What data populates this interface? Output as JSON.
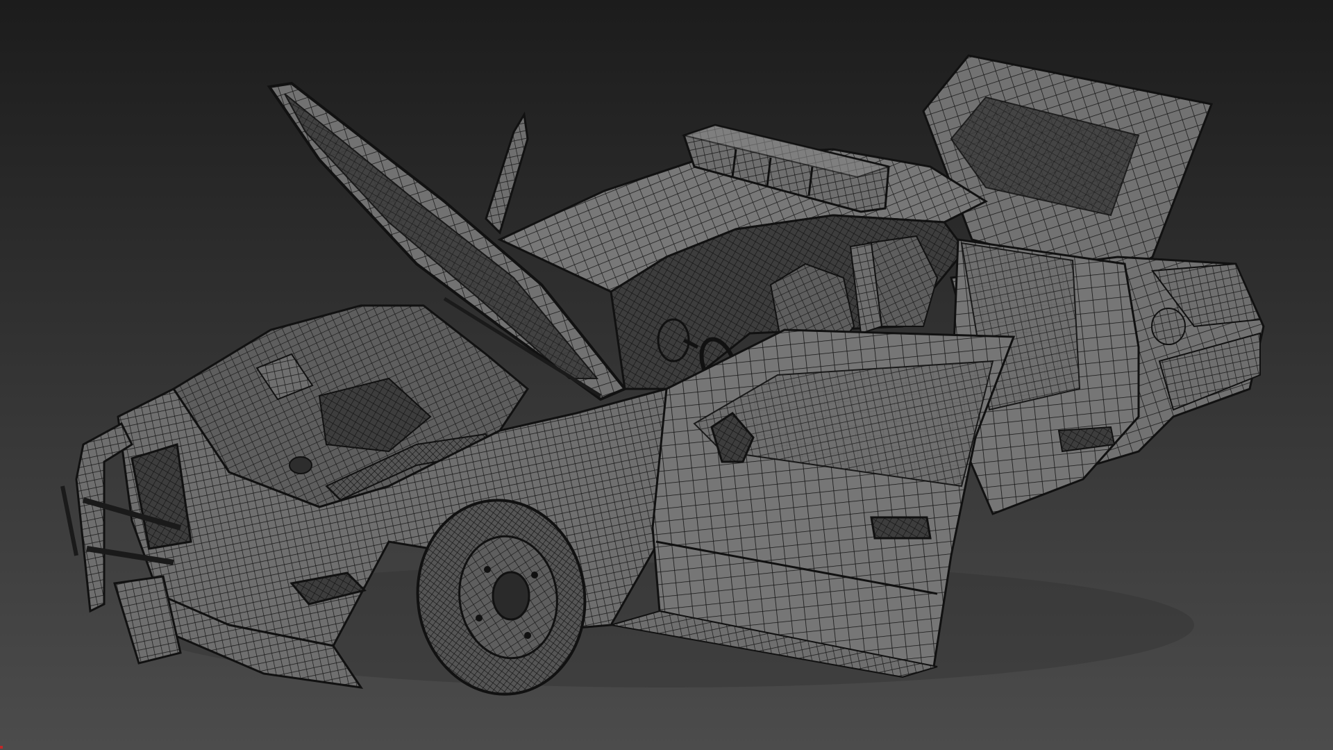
{
  "viewport": {
    "background_top": "#1c1c1c",
    "background_bottom": "#4c4c4c"
  },
  "model": {
    "subject": "police-sedan-wireframe",
    "display_mode": "wireframe-on-shaded",
    "surface_color": "#6f6f6f",
    "surface_dark": "#3a3a3a",
    "wire_color": "#151515",
    "highlight_color": "#9a9a9a",
    "parts_shown": {
      "hood": "open",
      "trunk": "open",
      "front_left_door": "open",
      "rear_left_door": "open",
      "front_left_window": "open",
      "lightbar": "present",
      "push_bumper": "present",
      "spotlight": "present"
    }
  },
  "axis_marker_color": "#c02828"
}
